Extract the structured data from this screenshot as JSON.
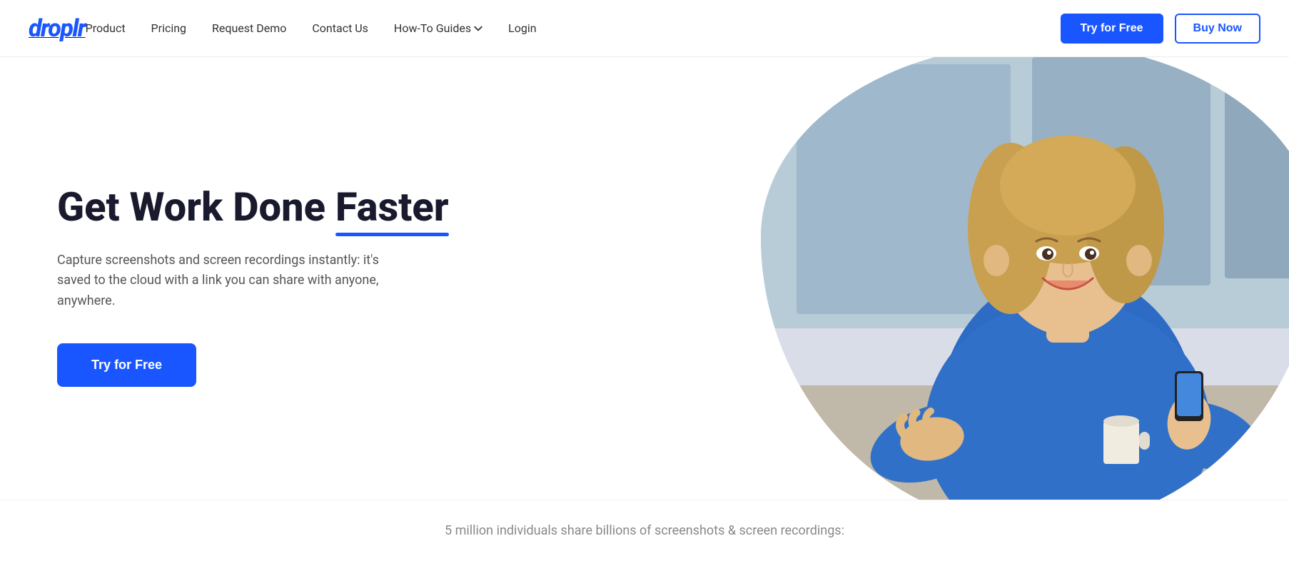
{
  "brand": {
    "name": "droplr",
    "logo_text": "droplr"
  },
  "nav": {
    "links": [
      {
        "label": "Product",
        "href": "#",
        "has_dropdown": false
      },
      {
        "label": "Pricing",
        "href": "#",
        "has_dropdown": false
      },
      {
        "label": "Request Demo",
        "href": "#",
        "has_dropdown": false
      },
      {
        "label": "Contact Us",
        "href": "#",
        "has_dropdown": false
      },
      {
        "label": "How-To Guides",
        "href": "#",
        "has_dropdown": true
      },
      {
        "label": "Login",
        "href": "#",
        "has_dropdown": false
      }
    ],
    "cta_primary": "Try for Free",
    "cta_secondary": "Buy Now"
  },
  "hero": {
    "title_part1": "Get Work Done ",
    "title_highlight": "Faster",
    "subtitle": "Capture screenshots and screen recordings instantly: it's saved to the cloud with a link you can share with anyone, anywhere.",
    "cta_button": "Try for Free"
  },
  "stats": {
    "text": "5 million individuals share billions of screenshots & screen recordings:"
  },
  "colors": {
    "brand_blue": "#1a56ff",
    "text_dark": "#1a1a2e",
    "text_muted": "#555",
    "text_light": "#888"
  }
}
